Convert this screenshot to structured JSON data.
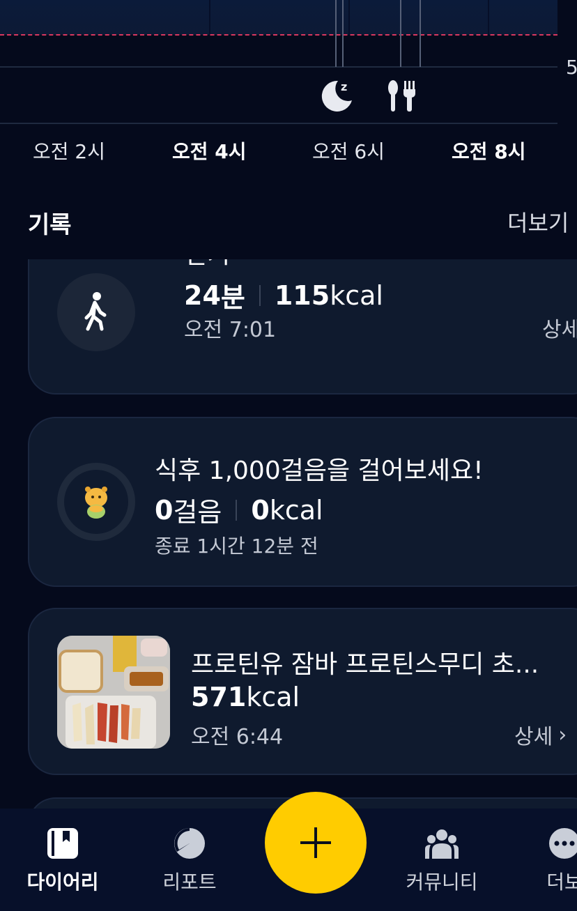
{
  "timeline": {
    "edge_label": "5",
    "time_labels": [
      "오전 2시",
      "오전 4시",
      "오전 6시",
      "오전 8시"
    ],
    "icons": [
      "sleep-moon-icon",
      "meal-utensils-icon"
    ],
    "colors": {
      "target_line": "#d9375f",
      "band": "#0b1b3a"
    }
  },
  "records": {
    "title": "기록",
    "more": "더보기"
  },
  "walk_card": {
    "icon": "walking-person-icon",
    "title": "걷기",
    "duration_value": "24",
    "duration_unit": "분",
    "kcal_value": "115",
    "kcal_unit": "kcal",
    "time": "오전 7:01",
    "detail": "상세"
  },
  "challenge_card": {
    "icon": "character-avatar-icon",
    "title": "식후 1,000걸음을 걸어보세요!",
    "steps_value": "0",
    "steps_unit": "걸음",
    "kcal_value": "0",
    "kcal_unit": "kcal",
    "ended": "종료 1시간 12분 전"
  },
  "meal_card": {
    "photo": "meal-photo",
    "title": "프로틴유 잠바 프로틴스무디 초...",
    "kcal_value": "571",
    "kcal_unit": "kcal",
    "time": "오전 6:44",
    "detail": "상세"
  },
  "bottom_nav": {
    "items": [
      {
        "label": "다이어리",
        "icon": "diary-book-icon"
      },
      {
        "label": "리포트",
        "icon": "report-pie-icon"
      },
      {
        "label": "커뮤니티",
        "icon": "community-people-icon"
      },
      {
        "label": "더보",
        "icon": "more-dots-icon"
      }
    ],
    "fab_icon": "plus-icon",
    "fab_color": "#ffcc00"
  }
}
